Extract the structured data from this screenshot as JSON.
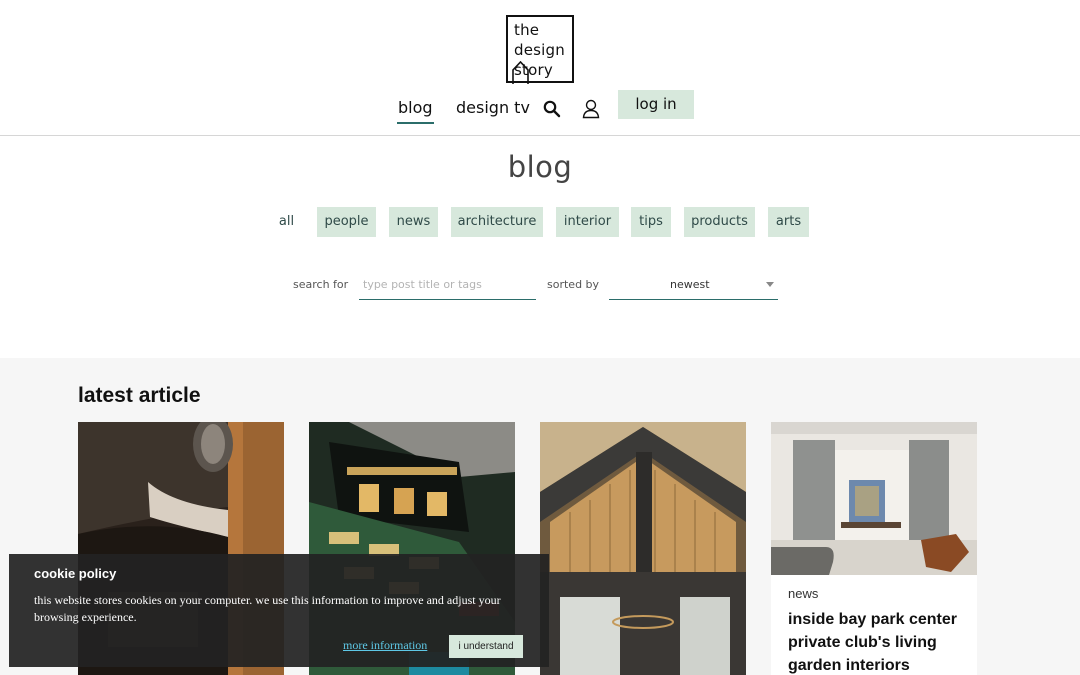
{
  "logo": {
    "line1": "the",
    "line2": "design",
    "line3": "story"
  },
  "nav": {
    "blog": "blog",
    "design_tv": "design tv",
    "search_icon": "search-icon",
    "user_icon": "user-icon",
    "login": "log in"
  },
  "page_title": "blog",
  "categories": [
    "all",
    "people",
    "news",
    "architecture",
    "interior",
    "tips",
    "products",
    "arts"
  ],
  "filter": {
    "search_label": "search for",
    "search_placeholder": "type post title or tags",
    "sort_label": "sorted by",
    "sort_value": "newest"
  },
  "latest": {
    "title": "latest article",
    "cards": [
      {
        "category": "",
        "title": ""
      },
      {
        "category": "",
        "title": ""
      },
      {
        "category": "",
        "title": ""
      },
      {
        "category": "news",
        "title": "inside bay park center private club's living garden interiors"
      }
    ]
  },
  "cookie": {
    "title": "cookie policy",
    "text": "this website stores cookies on your computer. we use this information to improve and adjust your browsing experience.",
    "more": "more information",
    "ok": "i understand"
  },
  "colors": {
    "accent": "#2b6d6a",
    "tag_bg": "#d7e8dc",
    "link": "#5ec8e6"
  }
}
